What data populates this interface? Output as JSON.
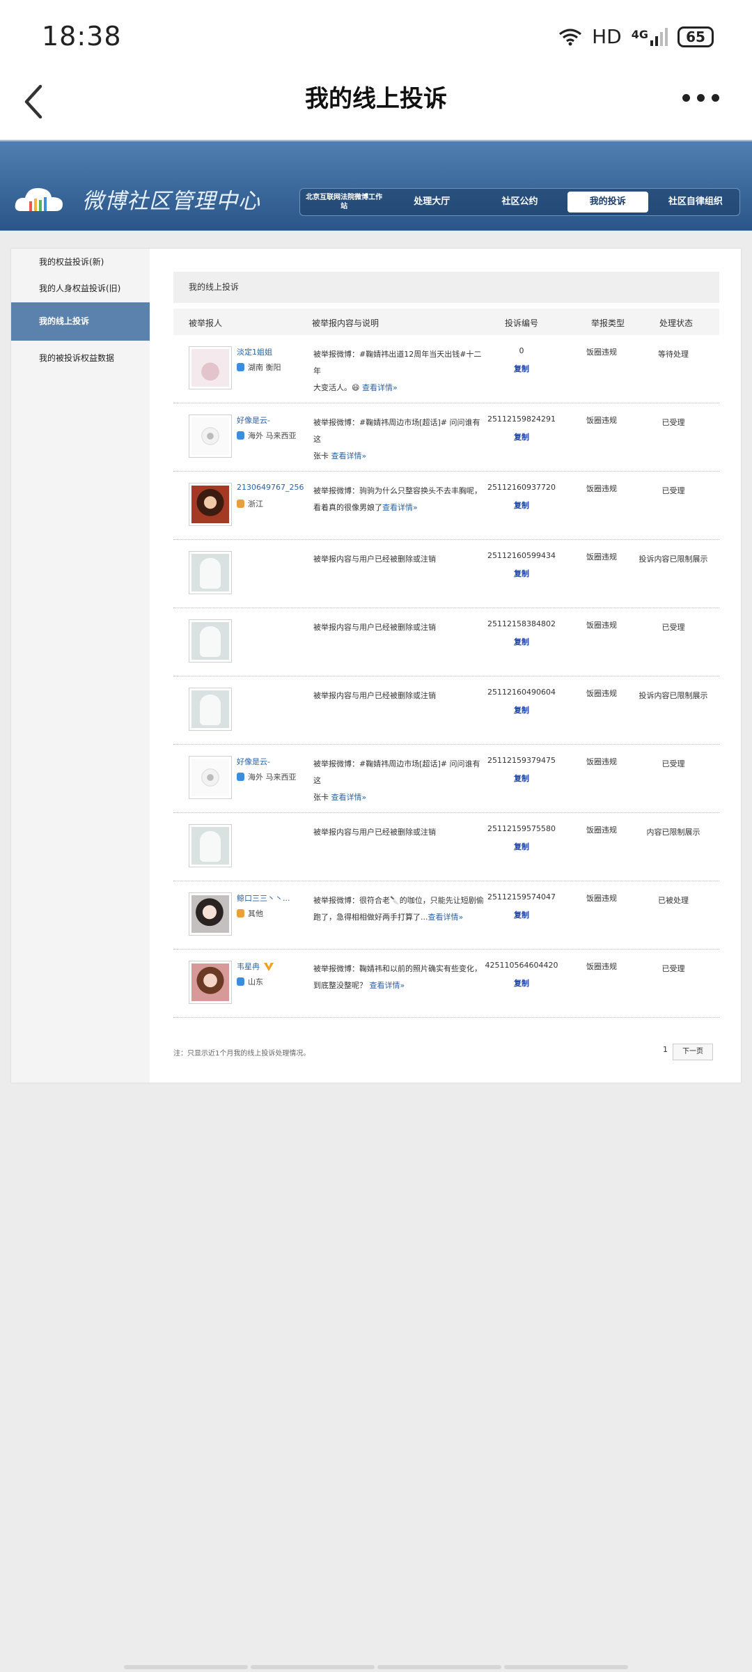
{
  "status_bar": {
    "time": "18:38",
    "network": "HD",
    "signal": "4G",
    "battery": "65"
  },
  "topbar": {
    "title": "我的线上投诉"
  },
  "banner": {
    "brand": "微博社区管理中心",
    "nav": [
      {
        "label": "北京互联网法院微博工作站",
        "active": false
      },
      {
        "label": "处理大厅",
        "active": false
      },
      {
        "label": "社区公约",
        "active": false
      },
      {
        "label": "我的投诉",
        "active": true
      },
      {
        "label": "社区自律组织",
        "active": false
      }
    ]
  },
  "sidebar": {
    "items": [
      {
        "label": "我的权益投诉(新)",
        "active": false
      },
      {
        "label": "我的人身权益投诉(旧)",
        "active": false
      },
      {
        "label": "我的线上投诉",
        "active": true
      },
      {
        "label": "我的被投诉权益数据",
        "active": false
      }
    ]
  },
  "main": {
    "section_title": "我的线上投诉",
    "columns": [
      "被举报人",
      "被举报内容与说明",
      "投诉编号",
      "举报类型",
      "处理状态"
    ],
    "copy_label": "复制",
    "detail_label": "查看详情»",
    "rows": [
      {
        "name": "淡定1姐姐",
        "location": "湖南 衡阳",
        "avatar": "rabbit",
        "desc1": "被举报微博：#鞠婧祎出道12周年当天出钱#十二年",
        "desc2": "大变活人。😄 ",
        "has_detail": true,
        "id": "0",
        "type": "饭圈违规",
        "status": "等待处理"
      },
      {
        "name": "好像是云-",
        "location": "海外 马来西亚",
        "avatar": "sketch",
        "desc1": "被举报微博：#鞠婧祎周边市场[超话]# 问问谁有这",
        "desc2": "张卡 ",
        "has_detail": true,
        "id": "25112159824291",
        "type": "饭圈违规",
        "status": "已受理"
      },
      {
        "name": "2130649767_256",
        "location": "浙江",
        "avatar": "face1",
        "desc1": "被举报微博：驹驹为什么只整容换头不去丰胸呢，",
        "desc2": "看着真的很像男娘了",
        "has_detail": true,
        "id": "25112160937720",
        "type": "饭圈违规",
        "status": "已受理"
      },
      {
        "name": "",
        "location": "",
        "avatar": "placeholder",
        "desc1": "被举报内容与用户已经被删除或注销",
        "desc2": "",
        "has_detail": false,
        "id": "25112160599434",
        "type": "饭圈违规",
        "status": "投诉内容已限制展示"
      },
      {
        "name": "",
        "location": "",
        "avatar": "placeholder",
        "desc1": "被举报内容与用户已经被删除或注销",
        "desc2": "",
        "has_detail": false,
        "id": "25112158384802",
        "type": "饭圈违规",
        "status": "已受理"
      },
      {
        "name": "",
        "location": "",
        "avatar": "placeholder",
        "desc1": "被举报内容与用户已经被删除或注销",
        "desc2": "",
        "has_detail": false,
        "id": "25112160490604",
        "type": "饭圈违规",
        "status": "投诉内容已限制展示"
      },
      {
        "name": "好像是云-",
        "location": "海外 马来西亚",
        "avatar": "sketch",
        "desc1": "被举报微博：#鞠婧祎周边市场[超话]# 问问谁有这",
        "desc2": "张卡 ",
        "has_detail": true,
        "id": "25112159379475",
        "type": "饭圈违规",
        "status": "已受理"
      },
      {
        "name": "",
        "location": "",
        "avatar": "placeholder",
        "desc1": "被举报内容与用户已经被删除或注销",
        "desc2": "",
        "has_detail": false,
        "id": "25112159575580",
        "type": "饭圈违规",
        "status": "内容已限制展示"
      },
      {
        "name": "鲸口三三丶丶...",
        "location": "其他",
        "avatar": "face2",
        "desc1": "被举报微博：很符合老🔪的咖位，只能先让短剧偷",
        "desc2": "跑了，急得相相做好两手打算了...",
        "has_detail": true,
        "id": "25112159574047",
        "type": "饭圈违规",
        "status": "已被处理"
      },
      {
        "name": "韦星冉",
        "location": "山东",
        "avatar": "face3",
        "desc1": "被举报微博：鞠婧祎和以前的照片确实有些变化，",
        "desc2": "到底整没整呢？ ",
        "has_detail": true,
        "id": "425110564604420",
        "type": "饭圈违规",
        "status": "已受理"
      }
    ],
    "note": "注：只显示近1个月我的线上投诉处理情况。",
    "page_number": "1",
    "next_label": "下一页"
  }
}
